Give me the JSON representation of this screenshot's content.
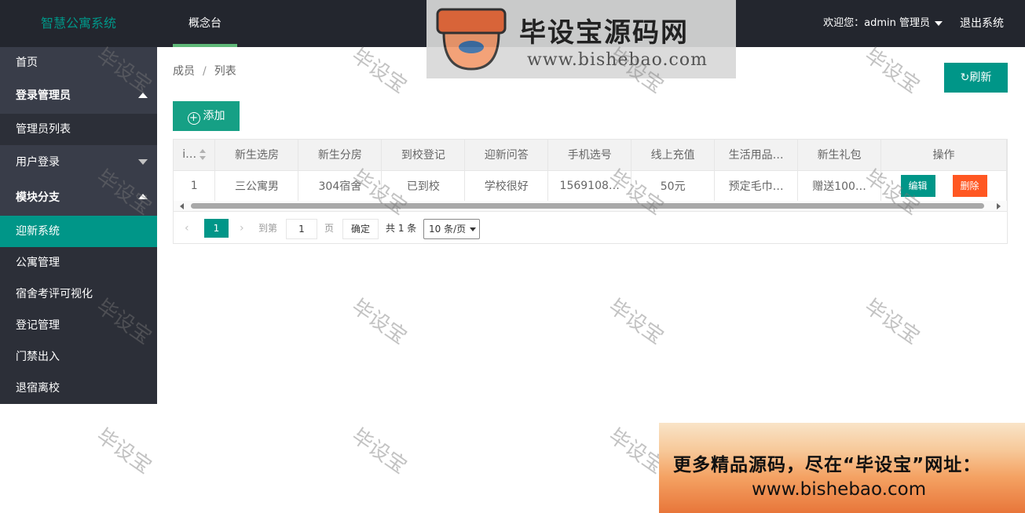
{
  "app": {
    "title": "智慧公寓系统"
  },
  "header": {
    "tab": "概念台",
    "welcome": "欢迎您：",
    "username": "admin 管理员",
    "logout": "退出系统"
  },
  "banner": {
    "title": "毕设宝源码网",
    "url": "www.bishebao.com",
    "badge": "毕设宝"
  },
  "sidebar": {
    "items": [
      {
        "label": "首页"
      },
      {
        "label": "登录管理员"
      },
      {
        "label": "管理员列表"
      },
      {
        "label": "用户登录"
      },
      {
        "label": "模块分支"
      },
      {
        "label": "迎新系统"
      },
      {
        "label": "公寓管理"
      },
      {
        "label": "宿舍考评可视化"
      },
      {
        "label": "登记管理"
      },
      {
        "label": "门禁出入"
      },
      {
        "label": "退宿离校"
      }
    ]
  },
  "breadcrumb": {
    "level1": "成员",
    "sep": "/",
    "level2": "列表"
  },
  "toolbar": {
    "refresh_label": "刷新",
    "add_label": "添加"
  },
  "table": {
    "headers": [
      "i…",
      "新生选房",
      "新生分房",
      "到校登记",
      "迎新问答",
      "手机选号",
      "线上充值",
      "生活用品…",
      "新生礼包",
      "操作"
    ],
    "rows": [
      {
        "cells": [
          "1",
          "三公寓男",
          "304宿舍",
          "已到校",
          "学校很好",
          "1569108…",
          "50元",
          "预定毛巾…",
          "赠送100…"
        ],
        "edit": "编辑",
        "delete": "删除"
      }
    ]
  },
  "pagination": {
    "current": "1",
    "goto": "到第",
    "page_input": "1",
    "page_unit": "页",
    "confirm": "确定",
    "total": "共 1 条",
    "page_size": "10 条/页"
  },
  "watermark": "毕设宝",
  "ad": {
    "line1": "更多精品源码，尽在“毕设宝”网址：",
    "line2": "www.bishebao.com"
  },
  "colors": {
    "primary": "#009688",
    "danger": "#ff5722",
    "header_bg": "#23262e",
    "sidebar_bg": "#393d49"
  }
}
